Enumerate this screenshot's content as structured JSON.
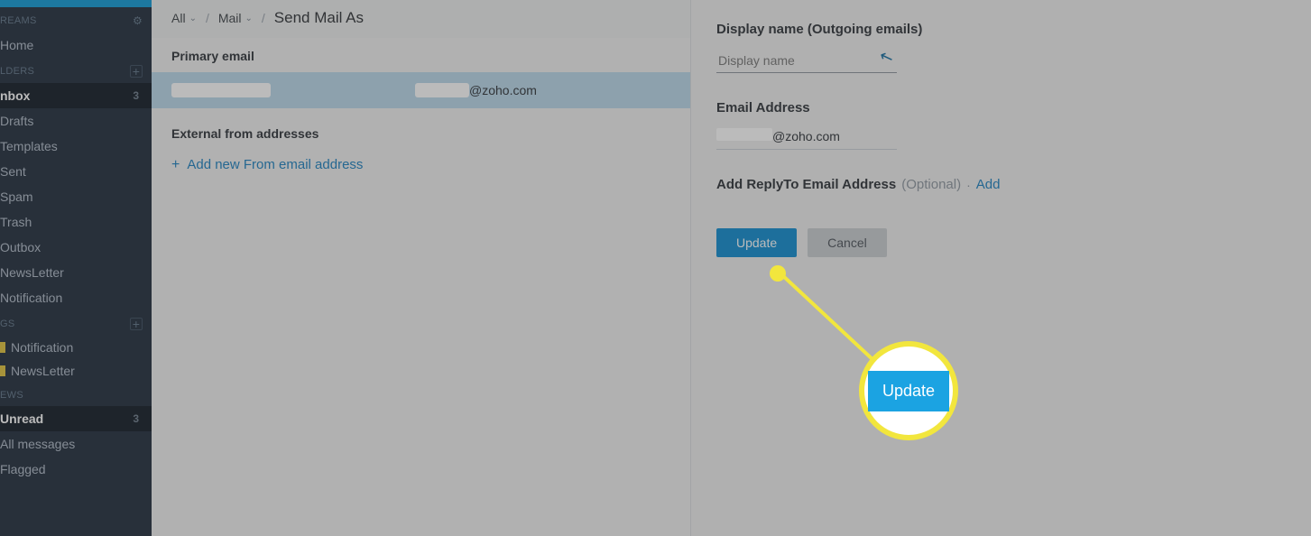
{
  "sidebar": {
    "streams_header": "REAMS",
    "home": "Home",
    "folders_header": "LDERS",
    "folders": [
      {
        "label": "nbox",
        "count": "3",
        "active": true
      },
      {
        "label": "Drafts"
      },
      {
        "label": "Templates"
      },
      {
        "label": "Sent"
      },
      {
        "label": "Spam"
      },
      {
        "label": "Trash"
      },
      {
        "label": "Outbox"
      },
      {
        "label": "NewsLetter"
      },
      {
        "label": "Notification"
      }
    ],
    "tags_header": "GS",
    "tags": [
      {
        "label": "Notification"
      },
      {
        "label": "NewsLetter"
      }
    ],
    "views_header": "EWS",
    "views": [
      {
        "label": "Unread",
        "count": "3",
        "active": true
      },
      {
        "label": "All messages"
      },
      {
        "label": "Flagged"
      }
    ]
  },
  "breadcrumb": {
    "all": "All",
    "mail": "Mail",
    "title": "Send Mail As"
  },
  "main": {
    "primary_label": "Primary email",
    "row_domain": "@zoho.com",
    "external_label": "External from addresses",
    "add_from": "Add new From email address"
  },
  "panel": {
    "display_name_label": "Display name (Outgoing emails)",
    "display_name_placeholder": "Display name",
    "email_label": "Email Address",
    "email_domain": "@zoho.com",
    "replyto_label": "Add ReplyTo Email Address",
    "replyto_optional": "(Optional)",
    "replyto_add": "Add",
    "update": "Update",
    "cancel": "Cancel"
  },
  "annotation": {
    "zoom_label": "Update"
  }
}
